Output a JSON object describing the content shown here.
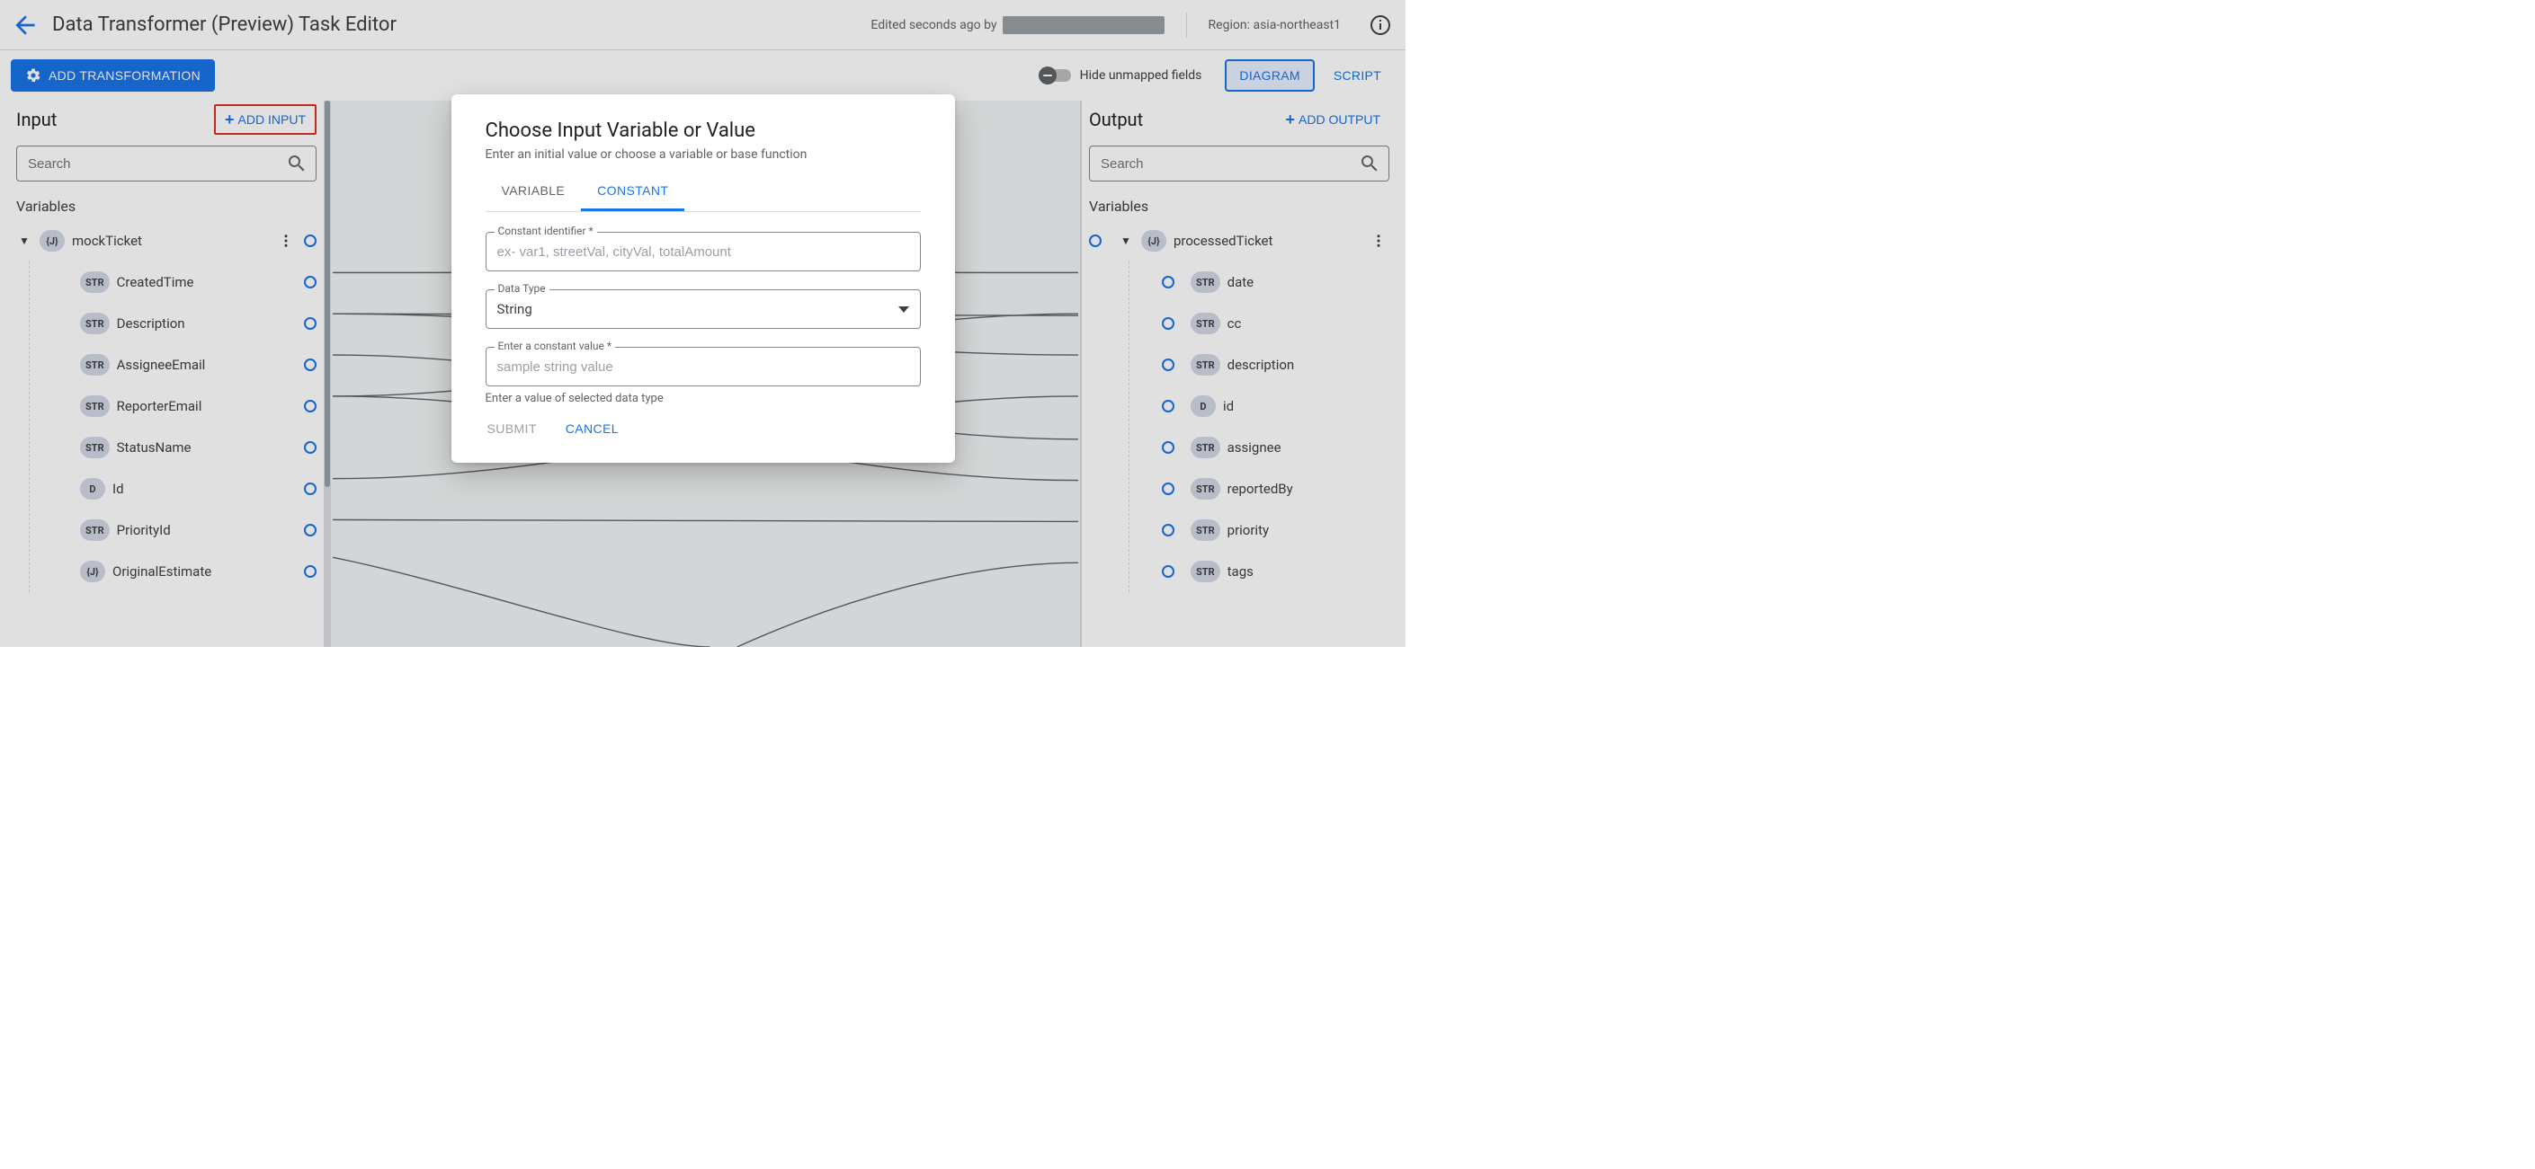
{
  "header": {
    "title": "Data Transformer (Preview) Task Editor",
    "edited_prefix": "Edited seconds ago by",
    "region_label": "Region:",
    "region_value": "asia-northeast1"
  },
  "toolbar": {
    "add_transformation": "ADD TRANSFORMATION",
    "hide_unmapped": "Hide unmapped fields",
    "view_diagram": "DIAGRAM",
    "view_script": "SCRIPT"
  },
  "input_panel": {
    "title": "Input",
    "add_button": "ADD INPUT",
    "search_placeholder": "Search",
    "section": "Variables",
    "root": {
      "label": "mockTicket",
      "badge": "{J}"
    },
    "fields": [
      {
        "badge": "STR",
        "label": "CreatedTime"
      },
      {
        "badge": "STR",
        "label": "Description"
      },
      {
        "badge": "STR",
        "label": "AssigneeEmail"
      },
      {
        "badge": "STR",
        "label": "ReporterEmail"
      },
      {
        "badge": "STR",
        "label": "StatusName"
      },
      {
        "badge": "D",
        "label": "Id"
      },
      {
        "badge": "STR",
        "label": "PriorityId"
      },
      {
        "badge": "{J}",
        "label": "OriginalEstimate"
      }
    ]
  },
  "output_panel": {
    "title": "Output",
    "add_button": "ADD OUTPUT",
    "search_placeholder": "Search",
    "section": "Variables",
    "root": {
      "label": "processedTicket",
      "badge": "{J}"
    },
    "fields": [
      {
        "badge": "STR",
        "label": "date"
      },
      {
        "badge": "STR",
        "label": "cc"
      },
      {
        "badge": "STR",
        "label": "description"
      },
      {
        "badge": "D",
        "label": "id"
      },
      {
        "badge": "STR",
        "label": "assignee"
      },
      {
        "badge": "STR",
        "label": "reportedBy"
      },
      {
        "badge": "STR",
        "label": "priority"
      },
      {
        "badge": "STR",
        "label": "tags"
      }
    ]
  },
  "modal": {
    "title": "Choose Input Variable or Value",
    "subtitle": "Enter an initial value or choose a variable or base function",
    "tab_variable": "VARIABLE",
    "tab_constant": "CONSTANT",
    "field_identifier_label": "Constant identifier *",
    "field_identifier_placeholder": "ex- var1, streetVal, cityVal, totalAmount",
    "field_datatype_label": "Data Type",
    "field_datatype_value": "String",
    "field_constvalue_label": "Enter a constant value *",
    "field_constvalue_placeholder": "sample string value",
    "helper": "Enter a value of selected data type",
    "submit": "SUBMIT",
    "cancel": "CANCEL"
  }
}
